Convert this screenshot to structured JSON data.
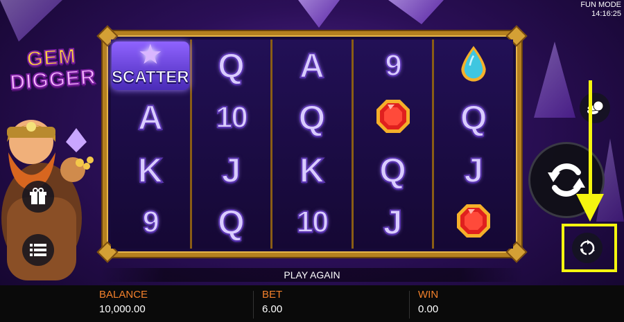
{
  "status": {
    "mode": "FUN MODE",
    "time": "14:16:25"
  },
  "logo": {
    "line1": "GEM",
    "line2": "DIGGER"
  },
  "reels": [
    [
      {
        "type": "scatter",
        "label": "SCATTER"
      },
      {
        "type": "text",
        "label": "A"
      },
      {
        "type": "text",
        "label": "K"
      },
      {
        "type": "text",
        "label": "9"
      }
    ],
    [
      {
        "type": "text",
        "label": "Q"
      },
      {
        "type": "text",
        "label": "10"
      },
      {
        "type": "text",
        "label": "J"
      },
      {
        "type": "text",
        "label": "Q"
      }
    ],
    [
      {
        "type": "text",
        "label": "A"
      },
      {
        "type": "text",
        "label": "Q"
      },
      {
        "type": "text",
        "label": "K"
      },
      {
        "type": "text",
        "label": "10"
      }
    ],
    [
      {
        "type": "text",
        "label": "9"
      },
      {
        "type": "gem",
        "gem": "red-gem"
      },
      {
        "type": "text",
        "label": "Q"
      },
      {
        "type": "text",
        "label": "J"
      }
    ],
    [
      {
        "type": "gem",
        "gem": "blue-gem"
      },
      {
        "type": "text",
        "label": "Q"
      },
      {
        "type": "text",
        "label": "J"
      },
      {
        "type": "gem",
        "gem": "red-gem"
      }
    ]
  ],
  "message": "PLAY AGAIN",
  "footer": {
    "balance_label": "BALANCE",
    "balance_value": "10,000.00",
    "bet_label": "BET",
    "bet_value": "6.00",
    "win_label": "WIN",
    "win_value": "0.00"
  },
  "buttons": {
    "gift": "gift-icon",
    "menu": "menu-icon",
    "bet": "coins-icon",
    "spin": "spin-icon",
    "autoplay": "autoplay-icon"
  },
  "colors": {
    "accent": "#f2802b",
    "annotation": "#f5f50f",
    "frame": "#b5801f"
  }
}
